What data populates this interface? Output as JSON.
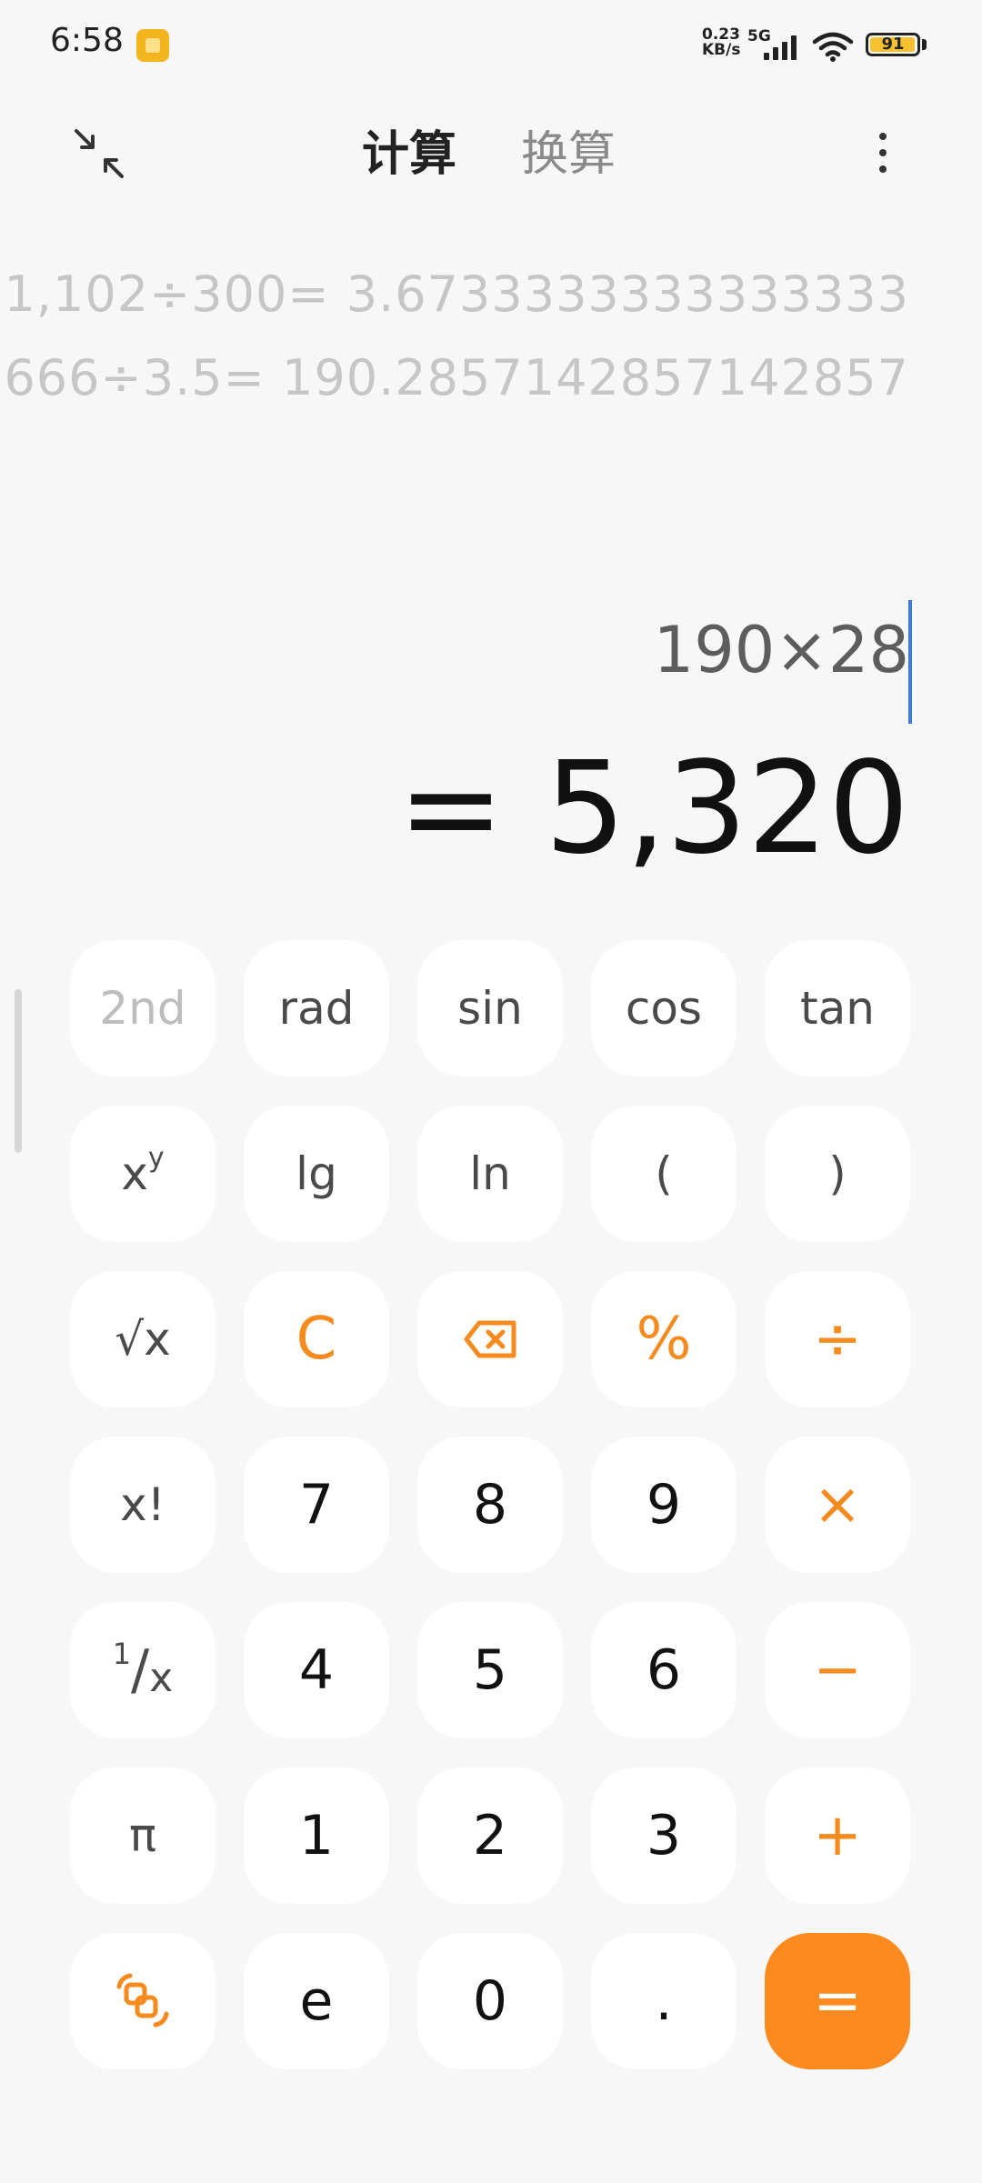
{
  "status_bar": {
    "time": "6:58",
    "net_speed_value": "0.23",
    "net_speed_unit": "KB/s",
    "network_type": "5G",
    "battery": "91"
  },
  "header": {
    "tab_calculate": "计算",
    "tab_convert": "换算"
  },
  "history": [
    "1,102÷300= 3.6733333333333333",
    "666÷3.5= 190.2857142857142857"
  ],
  "display": {
    "expression": "190×28",
    "result": "= 5,320"
  },
  "keys": {
    "second": "2nd",
    "rad": "rad",
    "sin": "sin",
    "cos": "cos",
    "tan": "tan",
    "pow_base": "x",
    "pow_exp": "y",
    "lg": "lg",
    "ln": "ln",
    "lparen": "(",
    "rparen": ")",
    "sqrt": "√x",
    "clear": "C",
    "percent": "%",
    "divide": "÷",
    "factorial": "x!",
    "seven": "7",
    "eight": "8",
    "nine": "9",
    "multiply": "×",
    "recip_num": "1",
    "recip_slash": "/",
    "recip_den": "x",
    "four": "4",
    "five": "5",
    "six": "6",
    "minus": "−",
    "pi": "π",
    "one": "1",
    "two": "2",
    "three": "3",
    "plus": "+",
    "e": "e",
    "zero": "0",
    "dot": ".",
    "equals": "="
  },
  "colors": {
    "accent": "#fd8a1e",
    "cursor": "#3a7be0",
    "key_background": "#ffffff",
    "page_background": "#f7f7f7"
  }
}
